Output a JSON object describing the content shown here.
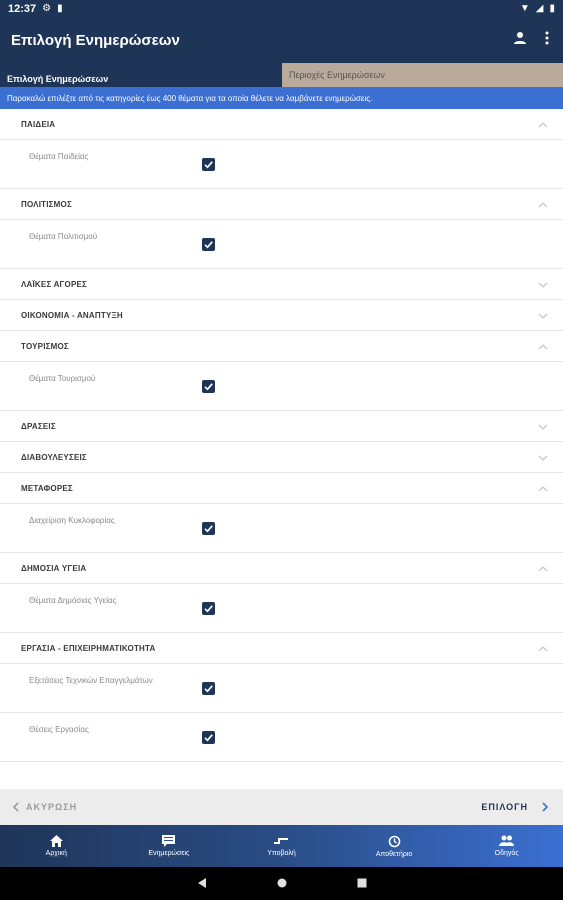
{
  "status_bar": {
    "time": "12:37",
    "icons_left": [
      "gear-icon",
      "sd-card-icon"
    ],
    "icons_right": [
      "wifi-icon",
      "signal-icon",
      "battery-icon"
    ]
  },
  "app_bar": {
    "title": "Επιλογή Ενημερώσεων",
    "actions": [
      "account-icon",
      "more-vert-icon"
    ]
  },
  "tabs": {
    "left": "Επιλογή Ενημερώσεων",
    "right": "Περιοχές Ενημερώσεων"
  },
  "banner": "Παρακαλώ επιλέξτε από τις κατηγορίες έως 400 θέματα για τα οποία θέλετε να λαμβάνετε ενημερώσεις.",
  "categories": [
    {
      "label": "ΠΑΙΔΕΙΑ",
      "expanded": true,
      "items": [
        {
          "label": "Θέματα Παιδείας",
          "checked": true
        }
      ]
    },
    {
      "label": "ΠΟΛΙΤΙΣΜΟΣ",
      "expanded": true,
      "items": [
        {
          "label": "Θέματα Πολιτισμού",
          "checked": true
        }
      ]
    },
    {
      "label": "ΛΑΪΚΕΣ ΑΓΟΡΕΣ",
      "expanded": false,
      "items": []
    },
    {
      "label": "ΟΙΚΟΝΟΜΙΑ - ΑΝΑΠΤΥΞΗ",
      "expanded": false,
      "items": []
    },
    {
      "label": "ΤΟΥΡΙΣΜΟΣ",
      "expanded": true,
      "items": [
        {
          "label": "Θέματα Τουρισμού",
          "checked": true
        }
      ]
    },
    {
      "label": "ΔΡΑΣΕΙΣ",
      "expanded": false,
      "items": []
    },
    {
      "label": "ΔΙΑΒΟΥΛΕΥΣΕΙΣ",
      "expanded": false,
      "items": []
    },
    {
      "label": "ΜΕΤΑΦΟΡΕΣ",
      "expanded": true,
      "items": [
        {
          "label": "Διαχείριση Κυκλοφορίας",
          "checked": true
        }
      ]
    },
    {
      "label": "ΔΗΜΟΣΙΑ ΥΓΕΙΑ",
      "expanded": true,
      "items": [
        {
          "label": "Θέματα Δημόσιας Υγείας",
          "checked": true
        }
      ]
    },
    {
      "label": "ΕΡΓΑΣΙΑ - ΕΠΙΧΕΙΡΗΜΑΤΙΚΟΤΗΤΑ",
      "expanded": true,
      "items": [
        {
          "label": "Εξετάσεις Τεχνικών Επαγγελμάτων",
          "checked": true
        },
        {
          "label": "Θέσεις Εργασίας",
          "checked": true
        }
      ]
    }
  ],
  "footer": {
    "cancel": "ΑΚΥΡΩΣΗ",
    "confirm": "ΕΠΙΛΟΓΗ"
  },
  "bottom_nav": [
    {
      "label": "Αρχική",
      "icon": "home-icon"
    },
    {
      "label": "Ενημερώσεις",
      "icon": "message-icon"
    },
    {
      "label": "Υποβολή",
      "icon": "submit-icon"
    },
    {
      "label": "Αποθετήριο",
      "icon": "history-icon"
    },
    {
      "label": "Οδηγός",
      "icon": "people-icon"
    }
  ],
  "colors": {
    "primary": "#1f3558",
    "accent": "#3b6fd1",
    "tab_inactive": "#b9aa9b"
  }
}
